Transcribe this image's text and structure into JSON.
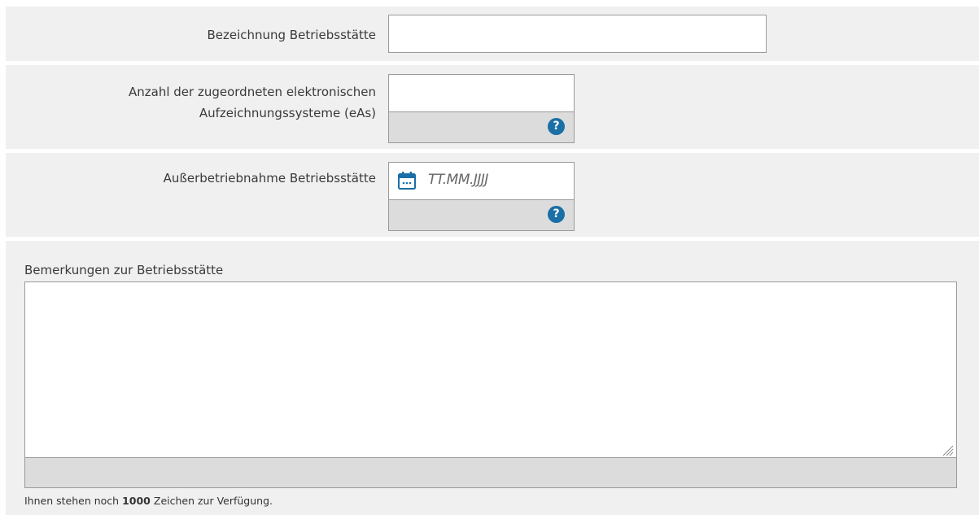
{
  "form": {
    "betriebsstaette": {
      "label": "Bezeichnung Betriebsstätte",
      "value": ""
    },
    "anzahl_eas": {
      "label_line1": "Anzahl der zugeordneten elektronischen",
      "label_line2": "Aufzeichnungssysteme (eAs)",
      "value": "",
      "help_glyph": "?"
    },
    "ausserbetriebnahme": {
      "label": "Außerbetriebnahme Betriebsstätte",
      "placeholder": "TT.MM.JJJJ",
      "icon": "calendar-icon",
      "help_glyph": "?"
    },
    "bemerkungen": {
      "label": "Bemerkungen zur Betriebsstätte",
      "value": "",
      "hint_prefix": "Ihnen stehen noch",
      "remaining_chars": "1000",
      "hint_suffix": "Zeichen zur Verfügung."
    }
  },
  "colors": {
    "row_background": "#f0f0f0",
    "field_footer": "#dcdcdc",
    "border": "#9a9a9a",
    "accent": "#1a6fa6"
  }
}
